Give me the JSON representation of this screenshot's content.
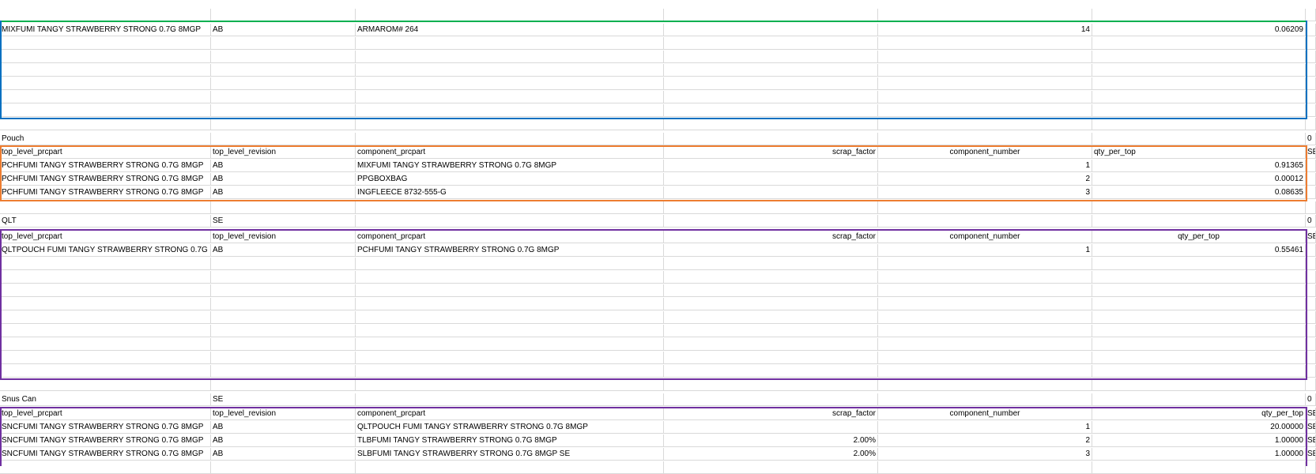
{
  "sections": [
    {
      "rows": [
        [
          "",
          "",
          "",
          "",
          "",
          "",
          ""
        ],
        [
          "MIXFUMI TANGY STRAWBERRY STRONG 0.7G 8MGP",
          "AB",
          "ARMAROM# 264",
          "",
          "14",
          "0.06209",
          ""
        ],
        [
          "",
          "",
          "",
          "",
          "",
          "",
          ""
        ],
        [
          "",
          "",
          "",
          "",
          "",
          "",
          ""
        ],
        [
          "",
          "",
          "",
          "",
          "",
          "",
          ""
        ],
        [
          "",
          "",
          "",
          "",
          "",
          "",
          ""
        ],
        [
          "",
          "",
          "",
          "",
          "",
          "",
          ""
        ],
        [
          "",
          "",
          "",
          "",
          "",
          "",
          ""
        ],
        [
          "",
          "",
          "",
          "",
          "",
          "",
          ""
        ]
      ]
    },
    {
      "rows": [
        [
          "Pouch",
          "",
          "",
          "",
          "",
          "",
          "0"
        ],
        [
          "top_level_prcpart",
          "top_level_revision",
          "component_prcpart",
          "scrap_factor",
          "component_number",
          "qty_per_top",
          "SE"
        ],
        [
          "PCHFUMI TANGY STRAWBERRY STRONG 0.7G 8MGP",
          "AB",
          "MIXFUMI TANGY STRAWBERRY STRONG 0.7G 8MGP",
          "",
          "1",
          "0.91365",
          ""
        ],
        [
          "PCHFUMI TANGY STRAWBERRY STRONG 0.7G 8MGP",
          "AB",
          "PPGBOXBAG",
          "",
          "2",
          "0.00012",
          ""
        ],
        [
          "PCHFUMI TANGY STRAWBERRY STRONG 0.7G 8MGP",
          "AB",
          "INGFLEECE 8732-555-G",
          "",
          "3",
          "0.08635",
          ""
        ],
        [
          "",
          "",
          "",
          "",
          "",
          "",
          ""
        ]
      ]
    },
    {
      "rows": [
        [
          "QLT",
          "SE",
          "",
          "",
          "",
          "",
          "0"
        ],
        [
          "top_level_prcpart",
          "top_level_revision",
          "component_prcpart",
          "scrap_factor",
          "component_number",
          "qty_per_top",
          "SE"
        ],
        [
          "QLTPOUCH FUMI TANGY STRAWBERRY STRONG 0.7G",
          "AB",
          "PCHFUMI TANGY STRAWBERRY STRONG 0.7G 8MGP",
          "",
          "1",
          "0.55461",
          ""
        ],
        [
          "",
          "",
          "",
          "",
          "",
          "",
          ""
        ],
        [
          "",
          "",
          "",
          "",
          "",
          "",
          ""
        ],
        [
          "",
          "",
          "",
          "",
          "",
          "",
          ""
        ],
        [
          "",
          "",
          "",
          "",
          "",
          "",
          ""
        ],
        [
          "",
          "",
          "",
          "",
          "",
          "",
          ""
        ],
        [
          "",
          "",
          "",
          "",
          "",
          "",
          ""
        ],
        [
          "",
          "",
          "",
          "",
          "",
          "",
          ""
        ],
        [
          "",
          "",
          "",
          "",
          "",
          "",
          ""
        ],
        [
          "",
          "",
          "",
          "",
          "",
          "",
          ""
        ],
        [
          "",
          "",
          "",
          "",
          "",
          "",
          ""
        ]
      ]
    },
    {
      "rows": [
        [
          "Snus Can",
          "SE",
          "",
          "",
          "",
          "",
          "0"
        ],
        [
          "top_level_prcpart",
          "top_level_revision",
          "component_prcpart",
          "scrap_factor",
          "component_number",
          "qty_per_top",
          "SE"
        ],
        [
          "SNCFUMI TANGY STRAWBERRY STRONG 0.7G 8MGP",
          "AB",
          "QLTPOUCH FUMI TANGY STRAWBERRY STRONG 0.7G 8MGP",
          "",
          "1",
          "20.00000",
          "SE"
        ],
        [
          "SNCFUMI TANGY STRAWBERRY STRONG 0.7G 8MGP",
          "AB",
          "TLBFUMI TANGY STRAWBERRY STRONG 0.7G 8MGP",
          "2.00%",
          "2",
          "1.00000",
          "SE"
        ],
        [
          "SNCFUMI TANGY STRAWBERRY STRONG 0.7G 8MGP",
          "AB",
          "SLBFUMI TANGY STRAWBERRY STRONG 0.7G 8MGP SE",
          "2.00%",
          "3",
          "1.00000",
          "SE"
        ],
        [
          "",
          "",
          "",
          "",
          "",
          "",
          ""
        ]
      ]
    }
  ]
}
